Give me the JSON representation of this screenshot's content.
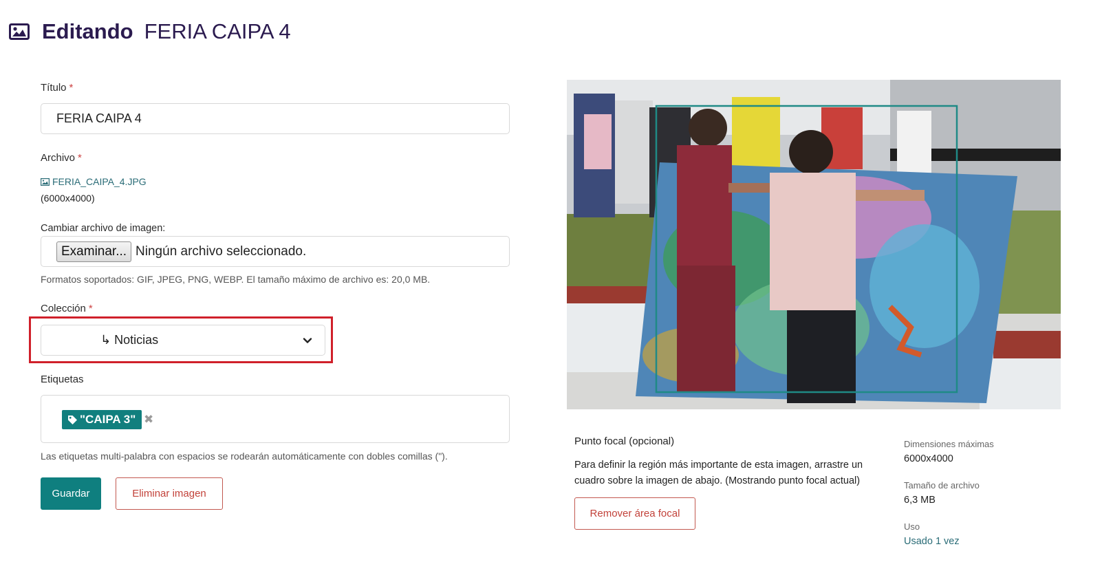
{
  "header": {
    "label": "Editando",
    "title": "FERIA CAIPA 4",
    "icon": "image-icon"
  },
  "form": {
    "title_label": "Título",
    "title_value": "FERIA CAIPA 4",
    "required_mark": "*",
    "file_label": "Archivo",
    "file_name": "FERIA_CAIPA_4.JPG",
    "file_dims": "(6000x4000)",
    "change_file_label": "Cambiar archivo de imagen:",
    "browse_button": "Examinar...",
    "no_file": "Ningún archivo seleccionado.",
    "formats_help": "Formatos soportados: GIF, JPEG, PNG, WEBP. El tamaño máximo de archivo es: 20,0 MB.",
    "collection_label": "Colección",
    "collection_value": "↳ Noticias",
    "tags_label": "Etiquetas",
    "tags": [
      "\"CAIPA 3\""
    ],
    "tag_remove": "✖",
    "tags_help": "Las etiquetas multi-palabra con espacios se rodearán automáticamente con dobles comillas (\").",
    "save_button": "Guardar",
    "delete_button": "Eliminar imagen"
  },
  "focal": {
    "title": "Punto focal (opcional)",
    "description": "Para definir la región más importante de esta imagen, arrastre un cuadro sobre la imagen de abajo. (Mostrando punto focal actual)",
    "remove_button": "Remover área focal"
  },
  "meta": {
    "max_dims_label": "Dimensiones máximas",
    "max_dims_value": "6000x4000",
    "file_size_label": "Tamaño de archivo",
    "file_size_value": "6,3 MB",
    "usage_label": "Uso",
    "usage_value": "Usado 1 vez"
  },
  "colors": {
    "primary": "#0f7f7f",
    "danger": "#c2423a",
    "heading": "#2b1b4f",
    "highlight": "#d0202a"
  }
}
